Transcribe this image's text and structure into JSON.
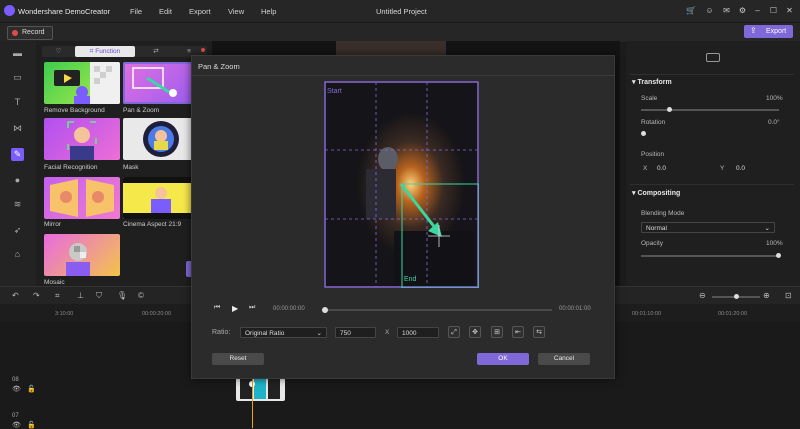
{
  "app": {
    "name": "Wondershare DemoCreator",
    "document_title": "Untitled Project"
  },
  "menu": [
    "File",
    "Edit",
    "Export",
    "View",
    "Help"
  ],
  "record_label": "Record",
  "export_label": "Export",
  "library": {
    "tab_active": "Function",
    "items": [
      {
        "label": "Remove Background"
      },
      {
        "label": "Pan & Zoom"
      },
      {
        "label": "Facial Recognition"
      },
      {
        "label": "Mask"
      },
      {
        "label": "Mirror"
      },
      {
        "label": "Cinema Aspect 21:9"
      },
      {
        "label": "Mosaic"
      }
    ]
  },
  "properties": {
    "transform_title": "Transform",
    "scale_label": "Scale",
    "scale_value": "100%",
    "scale_level": 0.2,
    "rotation_label": "Rotation",
    "rotation_value": "0.0°",
    "position_label": "Position",
    "x_label": "X",
    "x_value": "0.0",
    "y_label": "Y",
    "y_value": "0.0",
    "compositing_title": "Compositing",
    "blending_label": "Blending Mode",
    "blending_value": "Normal",
    "opacity_label": "Opacity",
    "opacity_value": "100%"
  },
  "timeline": {
    "ruler": [
      "3:10:00",
      "00:00:20:00",
      "00:01:10:00",
      "00:01:20:00"
    ],
    "tracks": [
      "08",
      "07"
    ]
  },
  "modal": {
    "title": "Pan & Zoom",
    "start_label": "Start",
    "end_label": "End",
    "time_start": "00:00:00:00",
    "time_end": "00:00:01:00",
    "ratio_label": "Ratio:",
    "ratio_value": "Original Ratio",
    "width_value": "750",
    "x_sep": "X",
    "height_value": "1000",
    "reset_label": "Reset",
    "ok_label": "OK",
    "cancel_label": "Cancel"
  },
  "colors": {
    "accent": "#7f68d8",
    "start_frame": "#8a6ad8",
    "end_frame": "#3dd6a0"
  }
}
